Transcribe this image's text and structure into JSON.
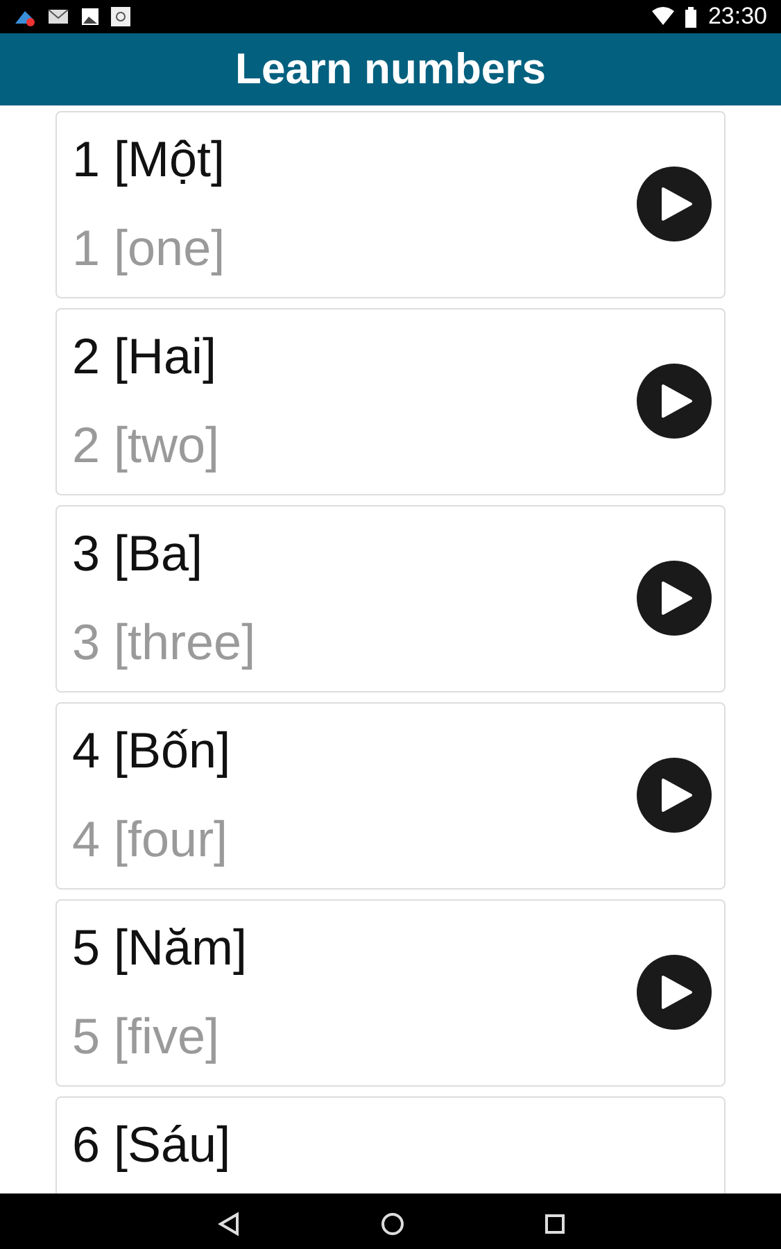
{
  "status_bar": {
    "time": "23:30"
  },
  "header": {
    "title": "Learn numbers"
  },
  "items": [
    {
      "word": "1 [Một]",
      "translation": "1 [one]"
    },
    {
      "word": "2 [Hai]",
      "translation": "2 [two]"
    },
    {
      "word": "3 [Ba]",
      "translation": "3 [three]"
    },
    {
      "word": "4 [Bốn]",
      "translation": "4 [four]"
    },
    {
      "word": "5 [Năm]",
      "translation": "5 [five]"
    },
    {
      "word": "6 [Sáu]"
    }
  ]
}
